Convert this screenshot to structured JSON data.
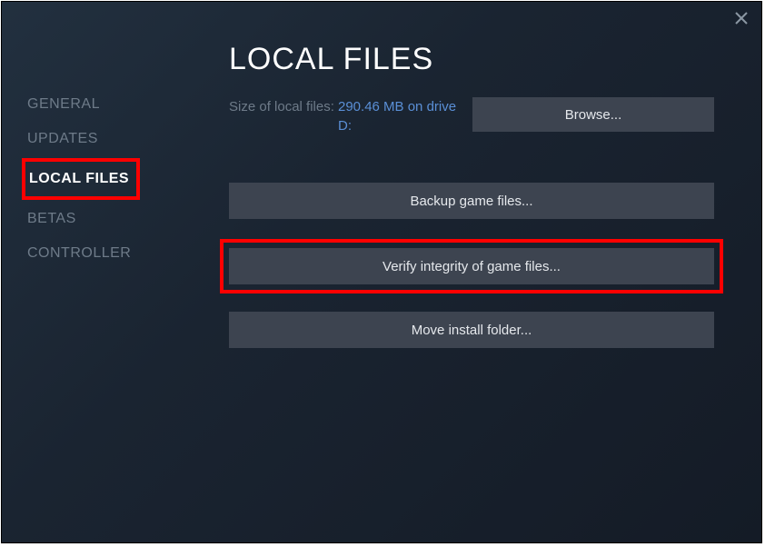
{
  "page_title": "LOCAL FILES",
  "sidebar": {
    "items": [
      {
        "label": "GENERAL"
      },
      {
        "label": "UPDATES"
      },
      {
        "label": "LOCAL FILES"
      },
      {
        "label": "BETAS"
      },
      {
        "label": "CONTROLLER"
      }
    ]
  },
  "size_section": {
    "label": "Size of local files:",
    "value": "290.46 MB on drive D:"
  },
  "buttons": {
    "browse": "Browse...",
    "backup": "Backup game files...",
    "verify": "Verify integrity of game files...",
    "move": "Move install folder..."
  }
}
